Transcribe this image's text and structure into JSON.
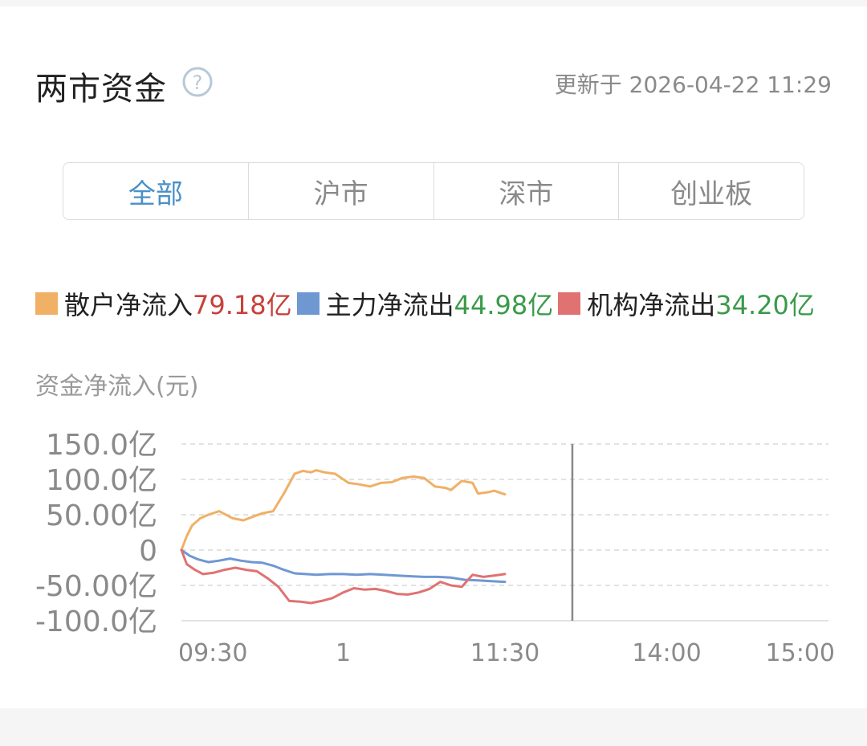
{
  "header": {
    "title": "两市资金",
    "updated": "更新于 2026-04-22 11:29"
  },
  "tabs": [
    {
      "label": "全部",
      "active": true
    },
    {
      "label": "沪市",
      "active": false
    },
    {
      "label": "深市",
      "active": false
    },
    {
      "label": "创业板",
      "active": false
    }
  ],
  "legend": [
    {
      "label": "散户净流入",
      "value": "79.18亿",
      "swatch": "#f0b066",
      "valueColor": "#c8403a"
    },
    {
      "label": "主力净流出",
      "value": "44.98亿",
      "swatch": "#6f98d2",
      "valueColor": "#3a9a4a"
    },
    {
      "label": "机构净流出",
      "value": "34.20亿",
      "swatch": "#e07272",
      "valueColor": "#3a9a4a"
    }
  ],
  "chart_data": {
    "type": "line",
    "ylabel": "资金净流入(元)",
    "ylim": [
      -100,
      150
    ],
    "y_ticks": [
      {
        "value": 150,
        "label": "150.0亿"
      },
      {
        "value": 100,
        "label": "100.0亿"
      },
      {
        "value": 50,
        "label": "50.00亿"
      },
      {
        "value": 0,
        "label": "0"
      },
      {
        "value": -50,
        "label": "-50.00亿"
      },
      {
        "value": -100,
        "label": "-100.0亿"
      }
    ],
    "x_ticks": [
      {
        "label": "09:30",
        "minute": 0
      },
      {
        "label": "1",
        "minute": 60
      },
      {
        "label": "11:30",
        "minute": 120
      },
      {
        "label": "14:00",
        "minute": 180
      },
      {
        "label": "15:00",
        "minute": 240
      }
    ],
    "x_domain_minutes": [
      0,
      240
    ],
    "lunch_break_minute": 145,
    "grid": true,
    "series": [
      {
        "name": "散户净流入",
        "color": "#f0b066",
        "x": [
          0,
          2,
          4,
          7,
          10,
          14,
          19,
          23,
          27,
          30,
          34,
          38,
          42,
          45,
          48,
          50,
          53,
          57,
          62,
          66,
          70,
          74,
          78,
          82,
          86,
          90,
          94,
          98,
          100,
          104,
          108,
          110,
          114,
          116,
          119,
          120
        ],
        "values": [
          0,
          20,
          35,
          45,
          50,
          55,
          45,
          42,
          48,
          52,
          55,
          80,
          108,
          112,
          110,
          113,
          110,
          108,
          95,
          93,
          90,
          95,
          96,
          102,
          104,
          102,
          90,
          88,
          85,
          98,
          95,
          80,
          82,
          84,
          80,
          79
        ]
      },
      {
        "name": "主力净流出",
        "color": "#6f98d2",
        "x": [
          0,
          3,
          6,
          10,
          14,
          18,
          22,
          26,
          30,
          34,
          38,
          42,
          46,
          50,
          55,
          60,
          65,
          70,
          75,
          80,
          85,
          90,
          95,
          100,
          105,
          110,
          115,
          120
        ],
        "values": [
          0,
          -8,
          -13,
          -17,
          -15,
          -12,
          -15,
          -17,
          -18,
          -22,
          -28,
          -33,
          -34,
          -35,
          -34,
          -34,
          -35,
          -34,
          -35,
          -36,
          -37,
          -38,
          -38,
          -39,
          -42,
          -43,
          -44,
          -45
        ]
      },
      {
        "name": "机构净流出",
        "color": "#e07272",
        "x": [
          0,
          2,
          5,
          8,
          12,
          16,
          20,
          24,
          28,
          32,
          36,
          40,
          44,
          48,
          52,
          56,
          60,
          64,
          68,
          72,
          76,
          80,
          84,
          88,
          92,
          96,
          100,
          104,
          108,
          112,
          116,
          120
        ],
        "values": [
          0,
          -20,
          -28,
          -34,
          -32,
          -28,
          -25,
          -28,
          -30,
          -40,
          -52,
          -72,
          -73,
          -75,
          -72,
          -68,
          -60,
          -54,
          -56,
          -55,
          -58,
          -62,
          -63,
          -60,
          -55,
          -45,
          -50,
          -52,
          -35,
          -38,
          -36,
          -34
        ]
      }
    ]
  }
}
